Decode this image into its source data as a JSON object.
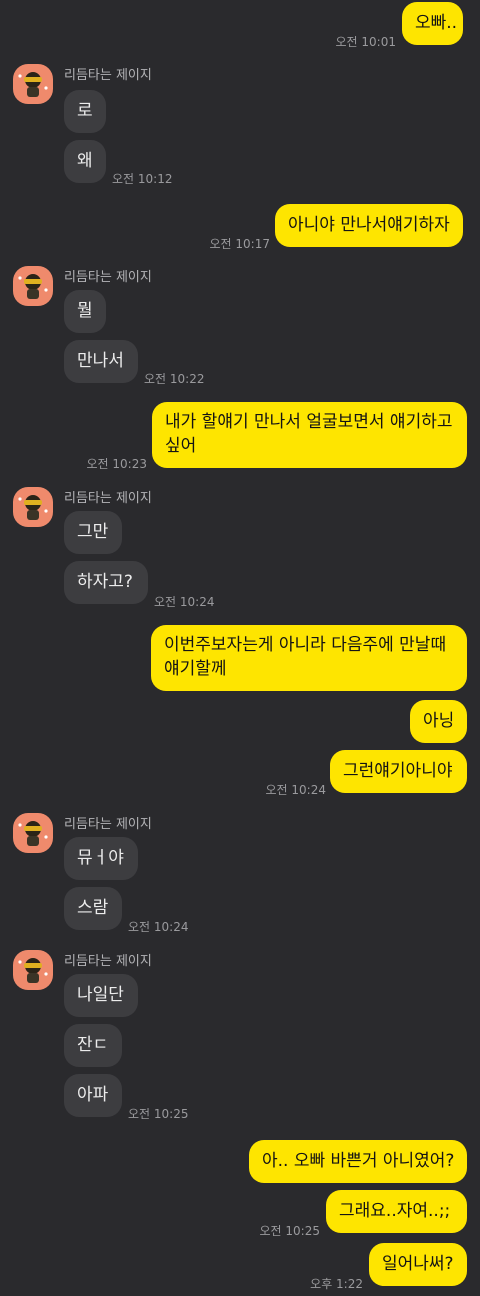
{
  "chat": {
    "partner_name": "리듬타는 제이지",
    "messages": [
      {
        "from": "me",
        "text": "오빠..",
        "time": "오전 10:01"
      },
      {
        "from": "them",
        "text": "로"
      },
      {
        "from": "them",
        "text": "왜",
        "time": "오전 10:12"
      },
      {
        "from": "me",
        "text": "아니야 만나서얘기하자",
        "time": "오전 10:17"
      },
      {
        "from": "them",
        "text": "뭘"
      },
      {
        "from": "them",
        "text": "만나서",
        "time": "오전 10:22"
      },
      {
        "from": "me",
        "line1": "내가 할얘기 만나서 얼굴보면서 얘기하고",
        "line2": "싶어",
        "time": "오전 10:23"
      },
      {
        "from": "them",
        "text": "그만"
      },
      {
        "from": "them",
        "text": "하자고?",
        "time": "오전 10:24"
      },
      {
        "from": "me",
        "line1": "이번주보자는게 아니라 다음주에 만날때",
        "line2": "얘기할께"
      },
      {
        "from": "me",
        "text": "아닝"
      },
      {
        "from": "me",
        "text": "그런얘기아니야",
        "time": "오전 10:24"
      },
      {
        "from": "them",
        "text": "뮤ㅓ야"
      },
      {
        "from": "them",
        "text": "스람",
        "time": "오전 10:24"
      },
      {
        "from": "them",
        "text": "나일단"
      },
      {
        "from": "them",
        "text": "잔ㄷ"
      },
      {
        "from": "them",
        "text": "아파",
        "time": "오전 10:25"
      },
      {
        "from": "me",
        "text": "아.. 오빠 바쁜거 아니였어?"
      },
      {
        "from": "me",
        "text": "그래요..자여..;;",
        "time": "오전 10:25"
      },
      {
        "from": "me",
        "text": "일어나써?",
        "time": "오후 1:22"
      }
    ]
  },
  "colors": {
    "background": "#2a2a2d",
    "my_bubble": "#fee500",
    "their_bubble": "#3d3d40",
    "avatar_bg": "#ef8a6c"
  },
  "icons": {
    "avatar": "jay-z-character-avatar-icon"
  }
}
